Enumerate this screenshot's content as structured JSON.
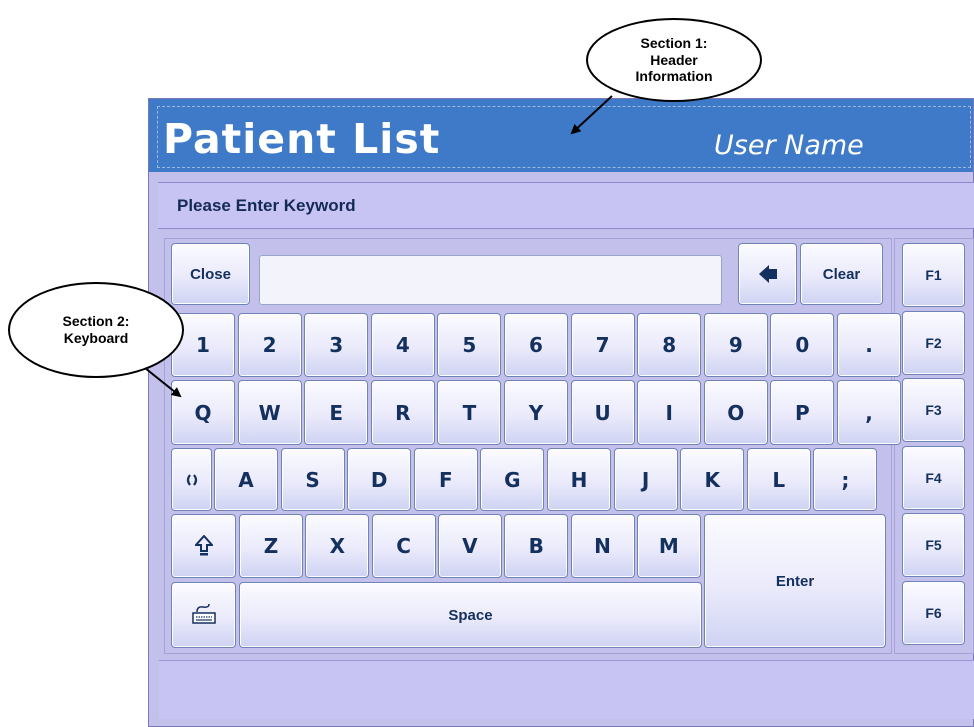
{
  "header": {
    "title": "Patient List",
    "user": "User Name"
  },
  "prompt": "Please Enter Keyword",
  "input": {
    "value": ""
  },
  "keys": {
    "close": "Close",
    "clear": "Clear",
    "enter": "Enter",
    "space": "Space",
    "backspace_icon": "left-arrow-icon",
    "shift_icon": "shift-up-arrow-icon",
    "keyboard_icon": "keyboard-icon",
    "special_icon": "parentheses-icon",
    "row_numbers": [
      "1",
      "2",
      "3",
      "4",
      "5",
      "6",
      "7",
      "8",
      "9",
      "0",
      "."
    ],
    "row_q": [
      "Q",
      "W",
      "E",
      "R",
      "T",
      "Y",
      "U",
      "I",
      "O",
      "P",
      ","
    ],
    "row_a": [
      "A",
      "S",
      "D",
      "F",
      "G",
      "H",
      "J",
      "K",
      "L",
      ";"
    ],
    "row_z": [
      "Z",
      "X",
      "C",
      "V",
      "B",
      "N",
      "M"
    ]
  },
  "function_keys": [
    "F1",
    "F2",
    "F3",
    "F4",
    "F5",
    "F6"
  ],
  "callouts": {
    "section1": "Section 1:\nHeader\nInformation",
    "section2": "Section 2:\nKeyboard"
  },
  "colors": {
    "header": "#3e7ac8",
    "panel": "#c3c0ec",
    "key_text": "#14305e"
  }
}
